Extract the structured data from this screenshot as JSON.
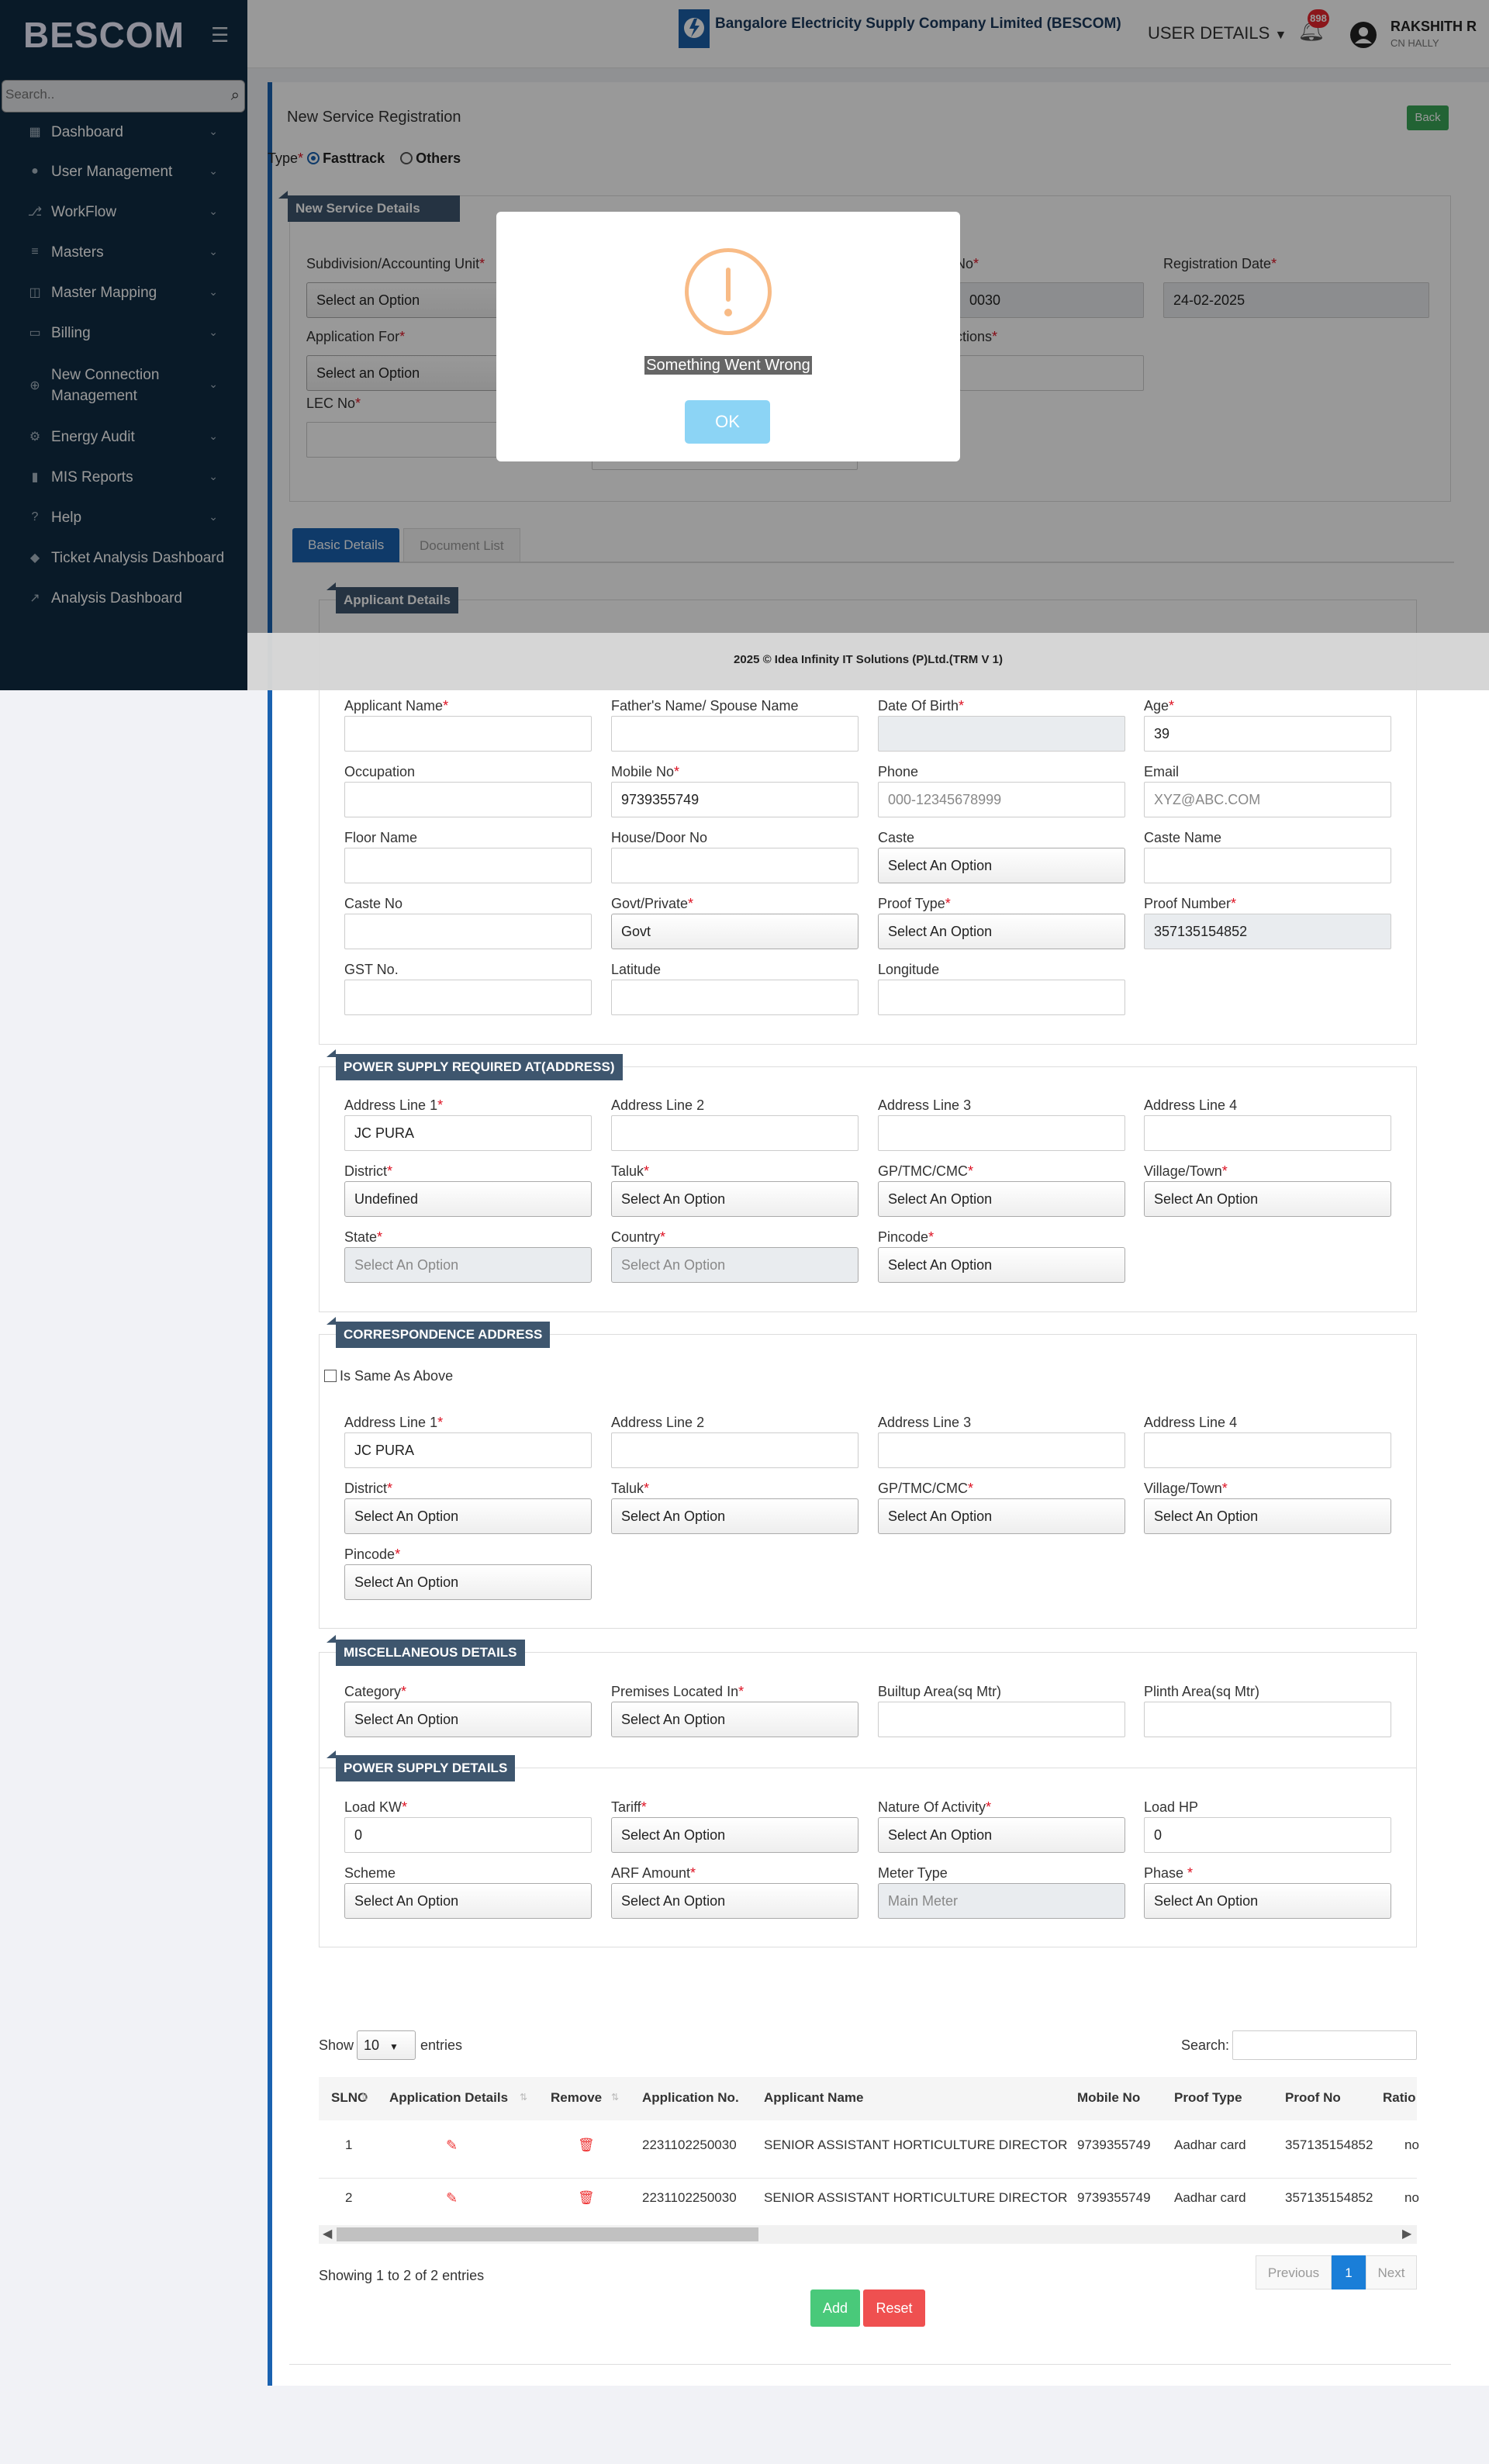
{
  "sidebar": {
    "brand": "BESCOM",
    "search_placeholder": "Search..",
    "items": [
      {
        "label": "Dashboard",
        "icon": "dashboard-icon"
      },
      {
        "label": "User Management",
        "icon": "user-icon"
      },
      {
        "label": "WorkFlow",
        "icon": "workflow-icon"
      },
      {
        "label": "Masters",
        "icon": "list-icon"
      },
      {
        "label": "Master Mapping",
        "icon": "map-icon"
      },
      {
        "label": "Billing",
        "icon": "monitor-icon"
      },
      {
        "label": "New Connection Management",
        "icon": "plus-circle-icon"
      },
      {
        "label": "Energy Audit",
        "icon": "cogs-icon"
      },
      {
        "label": "MIS Reports",
        "icon": "bar-chart-icon"
      },
      {
        "label": "Help",
        "icon": "question-icon"
      },
      {
        "label": "Ticket Analysis Dashboard",
        "icon": "tag-icon"
      },
      {
        "label": "Analysis Dashboard",
        "icon": "line-chart-icon"
      }
    ]
  },
  "header": {
    "company": "Bangalore Electricity Supply Company Limited (BESCOM)",
    "user_details": "USER DETAILS",
    "notifications": "898",
    "user_name": "RAKSHITH R",
    "user_sub": "CN HALLY"
  },
  "page": {
    "title": "New Service Registration",
    "back": "Back",
    "type_label": "Type",
    "type_fasttrack": "Fasttrack",
    "type_others": "Others"
  },
  "service": {
    "section": "New Service Details",
    "subdivision_label": "Subdivision/Accounting Unit",
    "subdivision_value": "Select an Option",
    "regno_label": "No",
    "regno_value": "0030",
    "regdate_label": "Registration Date",
    "regdate_value": "24-02-2025",
    "appfor_label": "Application For",
    "appfor_value": "Select an Option",
    "conn_label": "ctions",
    "lec_label": "LEC No"
  },
  "tabs": {
    "basic": "Basic Details",
    "docs": "Document List"
  },
  "applicant": {
    "section": "Applicant Details",
    "fields": [
      {
        "label": "Applicant Name",
        "req": true,
        "value": ""
      },
      {
        "label": "Father's Name/ Spouse Name",
        "req": false,
        "value": ""
      },
      {
        "label": "Date Of Birth",
        "req": true,
        "value": ""
      },
      {
        "label": "Age",
        "req": true,
        "value": "39"
      },
      {
        "label": "Occupation",
        "req": false,
        "value": ""
      },
      {
        "label": "Mobile No",
        "req": true,
        "value": "9739355749"
      },
      {
        "label": "Phone",
        "req": false,
        "value": "000-12345678999"
      },
      {
        "label": "Email",
        "req": false,
        "value": "XYZ@ABC.COM"
      },
      {
        "label": "Floor Name",
        "req": false,
        "value": ""
      },
      {
        "label": "House/Door No",
        "req": false,
        "value": ""
      },
      {
        "label": "Caste",
        "req": false,
        "value": "Select An Option"
      },
      {
        "label": "Caste Name",
        "req": false,
        "value": ""
      },
      {
        "label": "Caste No",
        "req": false,
        "value": ""
      },
      {
        "label": "Govt/Private",
        "req": true,
        "value": "Govt"
      },
      {
        "label": "Proof Type",
        "req": true,
        "value": "Select An Option"
      },
      {
        "label": "Proof Number",
        "req": true,
        "value": "357135154852"
      },
      {
        "label": "GST No.",
        "req": false,
        "value": ""
      },
      {
        "label": "Latitude",
        "req": false,
        "value": ""
      },
      {
        "label": "Longitude",
        "req": false,
        "value": ""
      }
    ]
  },
  "supply_address": {
    "section": "POWER SUPPLY REQUIRED AT(ADDRESS)",
    "fields": [
      {
        "label": "Address Line 1",
        "req": true,
        "value": "JC PURA"
      },
      {
        "label": "Address Line 2",
        "req": false,
        "value": ""
      },
      {
        "label": "Address Line 3",
        "req": false,
        "value": ""
      },
      {
        "label": "Address Line 4",
        "req": false,
        "value": ""
      },
      {
        "label": "District",
        "req": true,
        "value": "Undefined"
      },
      {
        "label": "Taluk",
        "req": true,
        "value": "Select An Option"
      },
      {
        "label": "GP/TMC/CMC",
        "req": true,
        "value": "Select An Option"
      },
      {
        "label": "Village/Town",
        "req": true,
        "value": "Select An Option"
      },
      {
        "label": "State",
        "req": true,
        "value": "Select An Option"
      },
      {
        "label": "Country",
        "req": true,
        "value": "Select An Option"
      },
      {
        "label": "Pincode",
        "req": true,
        "value": "Select An Option"
      }
    ]
  },
  "corr_address": {
    "section": "CORRESPONDENCE ADDRESS",
    "same_label": "Is Same As Above",
    "fields": [
      {
        "label": "Address Line 1",
        "req": true,
        "value": "JC PURA"
      },
      {
        "label": "Address Line 2",
        "req": false,
        "value": ""
      },
      {
        "label": "Address Line 3",
        "req": false,
        "value": ""
      },
      {
        "label": "Address Line 4",
        "req": false,
        "value": ""
      },
      {
        "label": "District",
        "req": true,
        "value": "Select An Option"
      },
      {
        "label": "Taluk",
        "req": true,
        "value": "Select An Option"
      },
      {
        "label": "GP/TMC/CMC",
        "req": true,
        "value": "Select An Option"
      },
      {
        "label": "Village/Town",
        "req": true,
        "value": "Select An Option"
      },
      {
        "label": "Pincode",
        "req": true,
        "value": "Select An Option"
      }
    ]
  },
  "misc": {
    "section": "MISCELLANEOUS DETAILS",
    "fields": [
      {
        "label": "Category",
        "req": true,
        "value": "Select An Option"
      },
      {
        "label": "Premises Located In",
        "req": true,
        "value": "Select An Option"
      },
      {
        "label": "Builtup Area(sq Mtr)",
        "req": false,
        "value": ""
      },
      {
        "label": "Plinth Area(sq Mtr)",
        "req": false,
        "value": ""
      }
    ]
  },
  "power": {
    "section": "POWER SUPPLY DETAILS",
    "fields": [
      {
        "label": "Load KW",
        "req": true,
        "value": "0"
      },
      {
        "label": "Tariff",
        "req": true,
        "value": "Select An Option"
      },
      {
        "label": "Nature Of Activity",
        "req": true,
        "value": "Select An Option"
      },
      {
        "label": "Load HP",
        "req": false,
        "value": "0"
      },
      {
        "label": "Scheme",
        "req": false,
        "value": "Select An Option"
      },
      {
        "label": "ARF Amount",
        "req": true,
        "value": "Select An Option"
      },
      {
        "label": "Meter Type",
        "req": false,
        "value": "Main Meter"
      },
      {
        "label": "Phase ",
        "req": true,
        "value": "Select An Option"
      }
    ]
  },
  "table": {
    "show": "Show",
    "entries_value": "10",
    "entries": "entries",
    "search": "Search:",
    "columns": [
      "SLNO",
      "Application Details",
      "Remove",
      "Application No.",
      "Applicant Name",
      "Mobile No",
      "Proof Type",
      "Proof No",
      "Ratio"
    ],
    "rows": [
      [
        "1",
        "",
        "",
        "2231102250030",
        "SENIOR ASSISTANT HORTICULTURE DIRECTOR",
        "9739355749",
        "Aadhar card",
        "357135154852",
        "no"
      ],
      [
        "2",
        "",
        "",
        "2231102250030",
        "SENIOR ASSISTANT HORTICULTURE DIRECTOR",
        "9739355749",
        "Aadhar card",
        "357135154852",
        "no"
      ]
    ],
    "info": "Showing 1 to 2 of 2 entries",
    "prev": "Previous",
    "page": "1",
    "next": "Next"
  },
  "actions": {
    "add": "Add",
    "reset": "Reset"
  },
  "footer": "2025 © Idea Infinity IT Solutions (P)Ltd.(TRM V 1)",
  "modal": {
    "message": "Something Went Wrong",
    "ok": "OK"
  }
}
